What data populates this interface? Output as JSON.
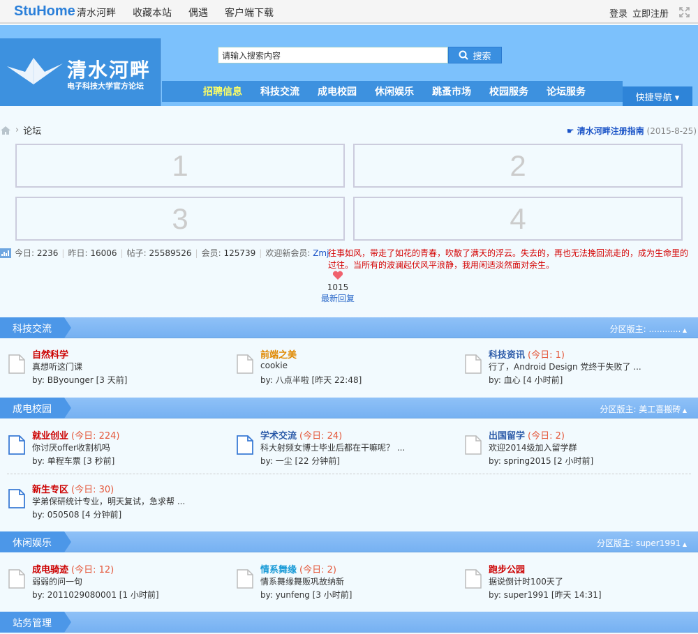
{
  "topbar": {
    "logo": "StuHome",
    "nav": [
      "清水河畔",
      "收藏本站",
      "偶遇",
      "客户端下载"
    ],
    "login": "登录",
    "register": "立即注册"
  },
  "header": {
    "brand": "清水河畔",
    "brand_sub": "电子科技大学官方论坛",
    "search_placeholder": "请输入搜索内容",
    "search_button": "搜索",
    "quick_nav": "快捷导航 ▾",
    "nav": [
      "招聘信息",
      "科技交流",
      "成电校园",
      "休闲娱乐",
      "跳蚤市场",
      "校园服务",
      "论坛服务"
    ],
    "nav_highlight_color": "#ffff66"
  },
  "breadcrumb": {
    "current": "论坛"
  },
  "notice": {
    "title": "☛ 清水河畔注册指南",
    "date": "(2015-8-25)"
  },
  "ads": [
    "1",
    "2",
    "3",
    "4"
  ],
  "stats": {
    "today_label": "今日:",
    "today": "2236",
    "yesterday_label": "昨日:",
    "yesterday": "16006",
    "posts_label": "帖子:",
    "posts": "25589526",
    "members_label": "会员:",
    "members": "125739",
    "welcome_label": "欢迎新会员:",
    "newest": "Zmj"
  },
  "motto": "往事如风，带走了如花的青春，吹散了满天的浮云。失去的，再也无法挽回流走的，成为生命里的过往。当所有的波澜起伏风平浪静，我用闲适淡然面对余生。",
  "like": {
    "count": "1015",
    "reply": "最新回复"
  },
  "sections": [
    {
      "title": "科技交流",
      "moderator": "分区版主: ............",
      "forums": [
        {
          "name": "自然科学",
          "today": "",
          "color": "#c00",
          "last": "真想听这门课",
          "by": "by: BByounger [3 天前]"
        },
        {
          "name": "前端之美",
          "today": "",
          "color": "#e08800",
          "last": "cookie",
          "by": "by: 八点半啦 [昨天 22:48]"
        },
        {
          "name": "科技资讯",
          "today": "(今日: 1)",
          "color": "#2b5aa8",
          "last": "行了，Android Design 党终于失败了 ...",
          "by": "by: 血心 [4 小时前]"
        }
      ]
    },
    {
      "title": "成电校园",
      "moderator": "分区版主: 美工喜搬砖",
      "forums": [
        {
          "name": "就业创业",
          "today": "(今日: 224)",
          "color": "#c00",
          "last": "你讨厌offer收割机吗",
          "by": "by: 单程车票 [3 秒前]"
        },
        {
          "name": "学术交流",
          "today": "(今日: 24)",
          "color": "#2b5aa8",
          "last": "科大射频女博士毕业后都在干嘛呢？ ...",
          "by": "by: 一尘 [22 分钟前]"
        },
        {
          "name": "出国留学",
          "today": "(今日: 2)",
          "color": "#2b5aa8",
          "last": "欢迎2014级加入留学群",
          "by": "by: spring2015 [2 小时前]"
        },
        {
          "name": "新生专区",
          "today": "(今日: 30)",
          "color": "#c00",
          "last": "学弟保研统计专业，明天复试，急求帮 ...",
          "by": "by: 050508 [4 分钟前]"
        }
      ]
    },
    {
      "title": "休闲娱乐",
      "moderator": "分区版主: super1991",
      "forums": [
        {
          "name": "成电骑迹",
          "today": "(今日: 12)",
          "color": "#c00",
          "last": "弱弱的问一句",
          "by": "by: 2011029080001 [1 小时前]"
        },
        {
          "name": "情系舞缘",
          "today": "(今日: 2)",
          "color": "#1a9bd7",
          "last": "情系舞缘舞贩巩故纳新",
          "by": "by: yunfeng [3 小时前]"
        },
        {
          "name": "跑步公园",
          "today": "",
          "color": "#c00",
          "last": "据说倒计时100天了",
          "by": "by: super1991 [昨天 14:31]"
        }
      ]
    },
    {
      "title": "站务管理",
      "moderator": "",
      "forums": []
    }
  ]
}
